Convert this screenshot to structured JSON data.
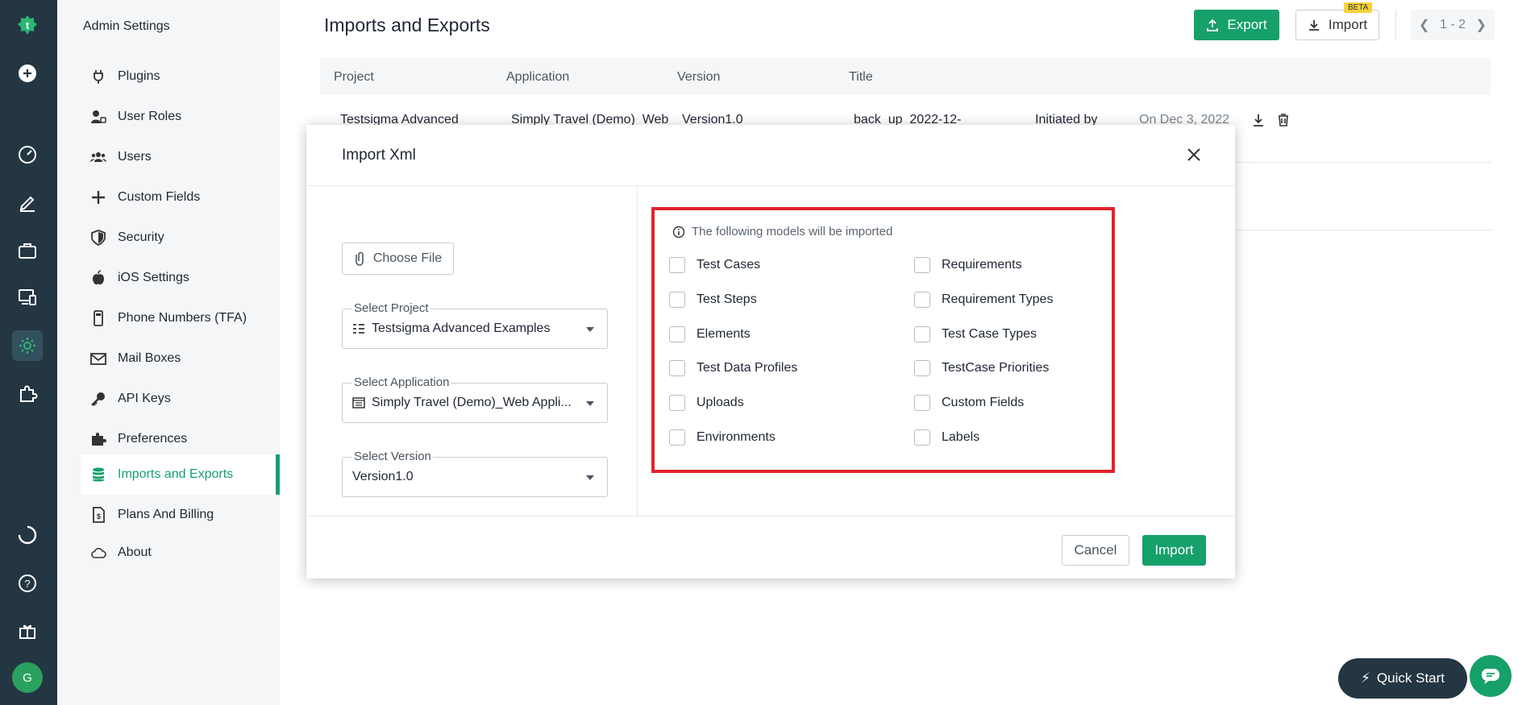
{
  "rail": {
    "avatar_initial": "G",
    "icons": [
      "testsigma-logo-icon",
      "add-circle-icon",
      "dashboard-gauge-icon",
      "edit-pen-icon",
      "briefcase-icon",
      "device-star-icon",
      "gear-icon",
      "puzzle-icon",
      "loading-circle-icon",
      "help-icon",
      "gift-icon"
    ]
  },
  "sidebar": {
    "title": "Admin Settings",
    "items": [
      {
        "label": "Plugins",
        "icon": "plug-icon"
      },
      {
        "label": "User Roles",
        "icon": "user-lock-icon"
      },
      {
        "label": "Users",
        "icon": "users-icon"
      },
      {
        "label": "Custom Fields",
        "icon": "plus-icon"
      },
      {
        "label": "Security",
        "icon": "shield-icon"
      },
      {
        "label": "iOS Settings",
        "icon": "apple-icon"
      },
      {
        "label": "Phone Numbers (TFA)",
        "icon": "phone-icon"
      },
      {
        "label": "Mail Boxes",
        "icon": "mail-icon"
      },
      {
        "label": "API Keys",
        "icon": "key-icon"
      },
      {
        "label": "Preferences",
        "icon": "puzzle-piece-icon"
      },
      {
        "label": "Imports and Exports",
        "icon": "database-icon",
        "active": true
      },
      {
        "label": "Plans And Billing",
        "icon": "invoice-icon"
      },
      {
        "label": "About",
        "icon": "cloud-icon"
      }
    ]
  },
  "header": {
    "title": "Imports and Exports",
    "export_label": "Export",
    "import_label": "Import",
    "beta_badge": "BETA",
    "pager_text": "1 - 2"
  },
  "table": {
    "columns": [
      "Project",
      "Application",
      "Version",
      "Title"
    ],
    "row1": {
      "project": "Testsigma Advanced",
      "application": "Simply Travel (Demo)_Web",
      "version": "Version1.0",
      "title": "back_up_2022-12-",
      "initiated": "Initiated by",
      "date": "On Dec 3, 2022"
    }
  },
  "modal": {
    "title": "Import Xml",
    "choose_file_label": "Choose File",
    "project_label": "Select Project",
    "project_value": "Testsigma Advanced Examples",
    "application_label": "Select Application",
    "application_value": "Simply Travel (Demo)_Web Appli...",
    "version_label": "Select Version",
    "version_value": "Version1.0",
    "info_text": "The following models will be imported",
    "models_left": [
      "Test Cases",
      "Test Steps",
      "Elements",
      "Test Data Profiles",
      "Uploads",
      "Environments"
    ],
    "models_right": [
      "Requirements",
      "Requirement Types",
      "Test Case Types",
      "TestCase Priorities",
      "Custom Fields",
      "Labels"
    ],
    "cancel_label": "Cancel",
    "import_label": "Import"
  },
  "footer": {
    "quick_start_label": "Quick Start"
  },
  "colors": {
    "accent": "#16a06a",
    "rail_bg": "#243642",
    "highlight": "#e3232c"
  }
}
